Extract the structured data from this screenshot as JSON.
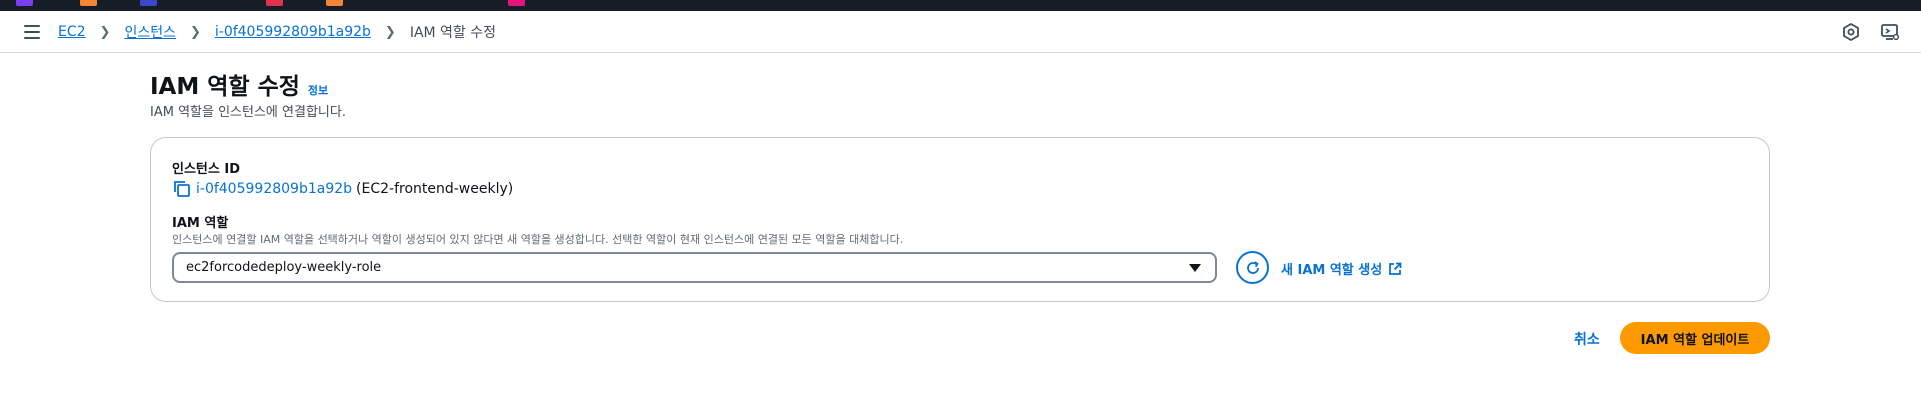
{
  "colors": {
    "topbar": "#161d26",
    "link": "#0972d3",
    "primary_button": "#ff9900",
    "favicons": [
      "#7b3ff2",
      "#f58536",
      "#3b48cc",
      "#dd344c",
      "#f58536",
      "#e7157b"
    ]
  },
  "header": {
    "menu_icon": "hamburger-menu-icon",
    "breadcrumbs": [
      "EC2",
      "인스턴스",
      "i-0f405992809b1a92b",
      "IAM 역할 수정"
    ],
    "right_icons": [
      "cloudshell-icon",
      "settings-icon"
    ]
  },
  "page": {
    "title": "IAM 역할 수정",
    "info_link": "정보",
    "description": "IAM 역할을 인스턴스에 연결합니다."
  },
  "form": {
    "instance_label": "인스턴스 ID",
    "instance_id": "i-0f405992809b1a92b",
    "instance_name": "(EC2-frontend-weekly)",
    "iam_label": "IAM 역할",
    "iam_description": "인스턴스에 연결할 IAM 역할을 선택하거나 역할이 생성되어 있지 않다면 새 역할을 생성합니다. 선택한 역할이 현재 인스턴스에 연결된 모든 역할을 대체합니다.",
    "iam_selected": "ec2forcodedeploy-weekly-role",
    "create_role_link": "새 IAM 역할 생성"
  },
  "actions": {
    "cancel": "취소",
    "update": "IAM 역할 업데이트"
  }
}
